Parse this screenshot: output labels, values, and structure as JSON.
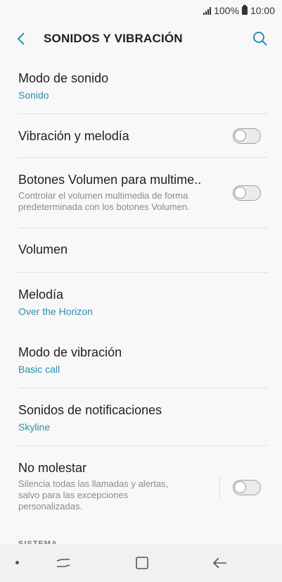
{
  "status": {
    "battery": "100%",
    "time": "10:00"
  },
  "header": {
    "title": "SONIDOS Y VIBRACIÓN"
  },
  "items": [
    {
      "title": "Modo de sonido",
      "value": "Sonido"
    },
    {
      "title": "Vibración y melodía",
      "toggle": false
    },
    {
      "title": "Botones Volumen para multime..",
      "description": "Controlar el volumen multimedia de forma predeterminada con los botones Volumen.",
      "toggle": false
    },
    {
      "title": "Volumen"
    },
    {
      "title": "Melodía",
      "value": "Over the Horizon"
    },
    {
      "title": "Modo de vibración",
      "value": "Basic call"
    },
    {
      "title": "Sonidos de notificaciones",
      "value": "Skyline"
    },
    {
      "title": "No molestar",
      "description": "Silencia todas las llamadas y alertas, salvo para las excepciones personalizadas.",
      "toggle": false
    }
  ],
  "section_peek": "SISTEMA",
  "colors": {
    "accent": "#2b8fb0",
    "background": "#f8f8f8"
  }
}
